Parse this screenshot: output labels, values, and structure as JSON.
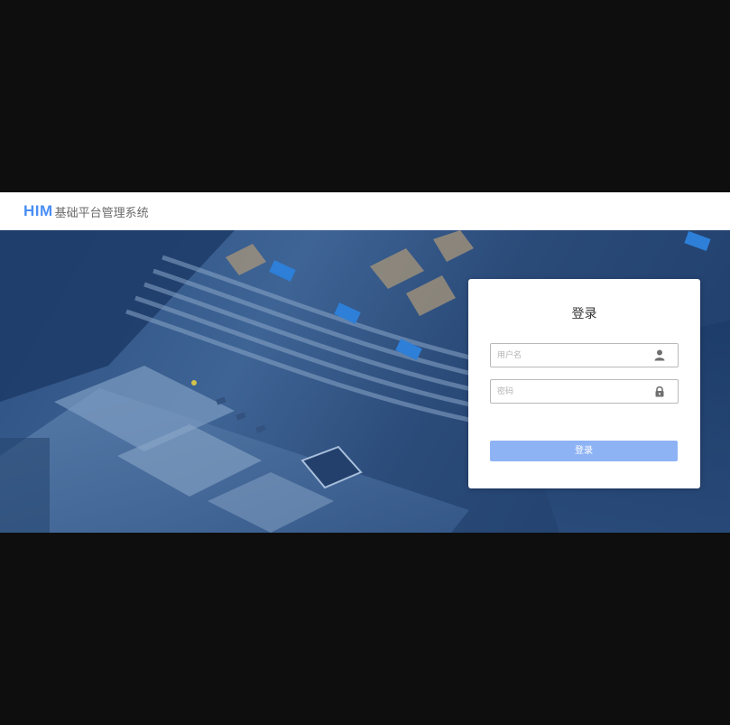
{
  "header": {
    "logo": "HIM",
    "system_name": "基础平台管理系统"
  },
  "login": {
    "title": "登录",
    "username": {
      "placeholder": "用户名",
      "value": "",
      "icon": "user-icon"
    },
    "password": {
      "placeholder": "密码",
      "value": "",
      "icon": "lock-icon"
    },
    "submit_label": "登录"
  },
  "colors": {
    "accent": "#4a8ef5",
    "button": "#8eb3f5",
    "page_background": "#0e0e0e",
    "hero_tint": "#2b4f80"
  }
}
